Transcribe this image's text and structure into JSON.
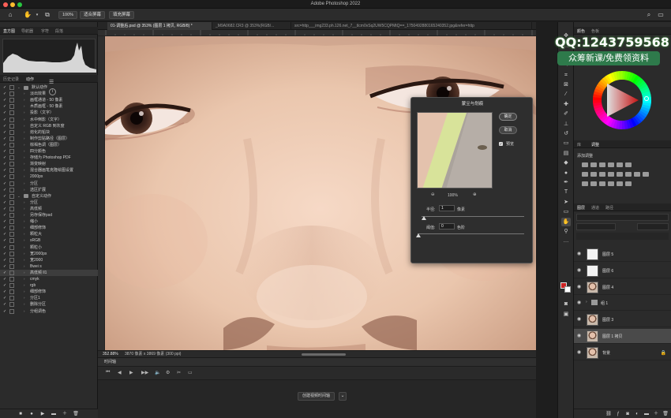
{
  "app": {
    "title": "Adobe Photoshop 2022"
  },
  "options": {
    "zoom_value": "100%",
    "fit_screen": "适合屏幕",
    "fill_screen": "填充屏幕"
  },
  "left_top_tabs": [
    "直方图",
    "导航器",
    "字符",
    "段落"
  ],
  "left_mid_tabs": [
    "历史记录",
    "动作"
  ],
  "actions": [
    {
      "label": "默认动作",
      "type": "folder"
    },
    {
      "label": "淡出效果",
      "type": "item"
    },
    {
      "label": "画框通道 - 50 像素",
      "type": "item"
    },
    {
      "label": "木质画框 - 50 像素",
      "type": "item"
    },
    {
      "label": "投影（文字）",
      "type": "item"
    },
    {
      "label": "水中倒影（文字）",
      "type": "item"
    },
    {
      "label": "自定义 RGB 到灰度",
      "type": "item"
    },
    {
      "label": "熔化的铅块",
      "type": "item"
    },
    {
      "label": "制作剪贴路径（图层）",
      "type": "item"
    },
    {
      "label": "棕褐色调（图层）",
      "type": "item"
    },
    {
      "label": "四分颜色",
      "type": "item"
    },
    {
      "label": "存储为 Photoshop PDF",
      "type": "item"
    },
    {
      "label": "渐变映射",
      "type": "item"
    },
    {
      "label": "混合器画笔克隆绘图设置",
      "type": "item"
    },
    {
      "label": "2000px",
      "type": "item"
    },
    {
      "label": "分区",
      "type": "item"
    },
    {
      "label": "选区扩展",
      "type": "item"
    },
    {
      "label": "自定义动作",
      "type": "folder"
    },
    {
      "label": "分区",
      "type": "item"
    },
    {
      "label": "高低频",
      "type": "item"
    },
    {
      "label": "另存保存psd",
      "type": "item"
    },
    {
      "label": "缩小",
      "type": "item"
    },
    {
      "label": "细部修饰",
      "type": "item"
    },
    {
      "label": "颗粒大",
      "type": "item"
    },
    {
      "label": "sRGB",
      "type": "item"
    },
    {
      "label": "颗粒小",
      "type": "item"
    },
    {
      "label": "宽2000px",
      "type": "item"
    },
    {
      "label": "宽2000",
      "type": "item"
    },
    {
      "label": "Bwei s",
      "type": "item"
    },
    {
      "label": "高低频 ll1",
      "type": "item",
      "selected": true
    },
    {
      "label": "cmyk",
      "type": "item"
    },
    {
      "label": "rgb",
      "type": "item"
    },
    {
      "label": "细部修饰",
      "type": "item"
    },
    {
      "label": "分区1",
      "type": "item"
    },
    {
      "label": "删除分区",
      "type": "item"
    },
    {
      "label": "分组调色",
      "type": "item"
    }
  ],
  "doc_tabs": [
    {
      "label": "01-调整后.psd @ 353% (图层 1 拷贝, RGB/8) *",
      "active": true
    },
    {
      "label": "_M9A0682.CR3 @ 353%(RGB/...",
      "active": false
    },
    {
      "label": "src=http___img233.ph.126.net_7__tlcm0vSq2UW5CQPMtQ==_1750492880165240352.jpg&refer=http",
      "active": false
    }
  ],
  "status": {
    "zoom": "352.88%",
    "doc_size": "3870 像素 x 3869 像素 (300 ppi)"
  },
  "timeline": {
    "title": "时间轴",
    "create_video": "创建视频时间轴"
  },
  "dialog": {
    "title": "蒙尘与划痕",
    "ok": "确定",
    "cancel": "取消",
    "preview": "预览",
    "zoom": "100%",
    "radius_label": "半径:",
    "radius_value": "1",
    "radius_unit": "像素",
    "threshold_label": "阈值:",
    "threshold_value": "0",
    "threshold_unit": "色阶"
  },
  "watermark": {
    "qq": "QQ:1243759568",
    "text": "众筹新课/免费领资料"
  },
  "right_tabs_top": [
    "颜色",
    "色板"
  ],
  "right_tabs_mid": [
    "库",
    "调整"
  ],
  "adjust_title": "添加调整",
  "layer_tabs": [
    "图层",
    "通道",
    "路径"
  ],
  "layers": [
    {
      "name": "图层 5",
      "thumb": "white",
      "selected": false
    },
    {
      "name": "图层 6",
      "thumb": "white",
      "selected": false
    },
    {
      "name": "图层 4",
      "thumb": "face",
      "selected": false
    },
    {
      "name": "组 1",
      "thumb": "folder",
      "selected": false
    },
    {
      "name": "图层 3",
      "thumb": "face",
      "selected": false
    },
    {
      "name": "图层 1 拷贝",
      "thumb": "face",
      "selected": true
    },
    {
      "name": "背景",
      "thumb": "face",
      "selected": false
    }
  ],
  "colors": {
    "foreground": "#cc2222",
    "background": "#ffffff",
    "watermark_bg": "#2e7a4b"
  }
}
